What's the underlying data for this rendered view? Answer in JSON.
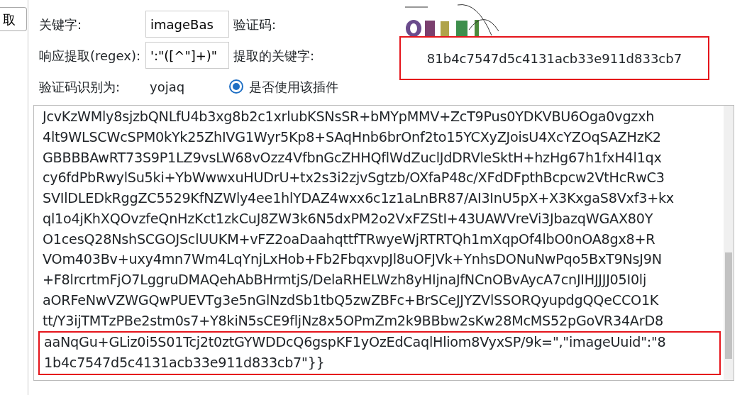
{
  "side_button": {
    "label": "取"
  },
  "form": {
    "keyword_label": "关键字:",
    "keyword_value": "imageBas",
    "captcha_label": "验证码:",
    "regex_label": "响应提取(regex):",
    "regex_value": "':\"([^\"]+)\"",
    "extracted_label": "提取的关键字:",
    "extracted_value": "81b4c7547d5c4131acb33e911d833cb7",
    "recognized_label": "验证码识别为:",
    "recognized_value": "yojaq",
    "plugin_option": {
      "label": "是否使用该插件",
      "selected": true
    }
  },
  "response_lines": [
    {
      "text": "JcvKzWMly8sjzbQNLfU4b3xg8b2c1xrlubKSNsSR+bMYpMMV+ZcT9Pus0YDKVBU6Oga0vgzxh",
      "highlighted": false
    },
    {
      "text": "4lt9WLSCWcSPM0kYk25ZhIVG1Wyr5Kp8+SAqHnb6brOnf2to15YCXyZJoisU4XcYZOqSAZHzK2",
      "highlighted": false
    },
    {
      "text": "GBBBBAwRT73S9P1LZ9vsLW68vOzz4VfbnGcZHHQflWdZuclJdDRVleSktH+hzHg67h1fxH4l1qx",
      "highlighted": false
    },
    {
      "text": "cy6fdPbRwylSu5ki+YbWwwxuHUDrU+tx2s3i2zjvSgtzb/OXfaP48c/XFdDFpthBcpcw2VtHcRwC3",
      "highlighted": false
    },
    {
      "text": "SVIlDLEDkRggZC5529KfNZWly4ee1hlYDAZ4wxx6c1z1aLnBR87/AI3InU5pX+X3KxgaS8Vxf3+kx",
      "highlighted": false
    },
    {
      "text": "ql1o4jKhXQOvzfeQnHzKct1zkCuJ8ZW3k6N5dxPM2o2VxFZStI+43UAWVreVi3JbazqWGAX80Y",
      "highlighted": false
    },
    {
      "text": "O1cesQ28NshSCGOJSclUUKM+vFZ2oaDaahqttfTRwyeWjRTRTQh1mXqpOf4lbO0nOA8gx8+R",
      "highlighted": false
    },
    {
      "text": "VOm403Bv+uxy4mn7Wm4LqYnjLxHob+Fb2FbqxvpJl8uOFJVk+YnhsDONuNwPqo5BxT9NsJ9N",
      "highlighted": false
    },
    {
      "text": "+F8lrcrtmFjO7LggruDMAQehAbBHrmtjS/DelaRHELWzh8yHIjnaJfNCnOBvAycA7cnJIHJJJJ05I0lj",
      "highlighted": false
    },
    {
      "text": "aORFeNwVZWGQwPUEVTg3e5nGlNzdSb1tbQ5zwZBFc+BrSCeJJYZVlSSORQyupdgQQeCCO1K",
      "highlighted": false
    },
    {
      "text": "tt/Y3ijTMTzPBe2stm0s7+Y8kiN5sCE9fljNz8x5OPmZm2k9BBbw2sKw28McMS52pGoVR34ArD8",
      "highlighted": false
    },
    {
      "text": "aaNqGu+GLiz0i5S01Tcj2t0ztGYWDDcQ6gspKF1yOzEdCaqlHliom8VyxSP/9k=\",\"imageUuid\":\"8",
      "highlighted": true
    },
    {
      "text": "1b4c7547d5c4131acb33e911d833cb7\"}}",
      "highlighted": true
    }
  ]
}
